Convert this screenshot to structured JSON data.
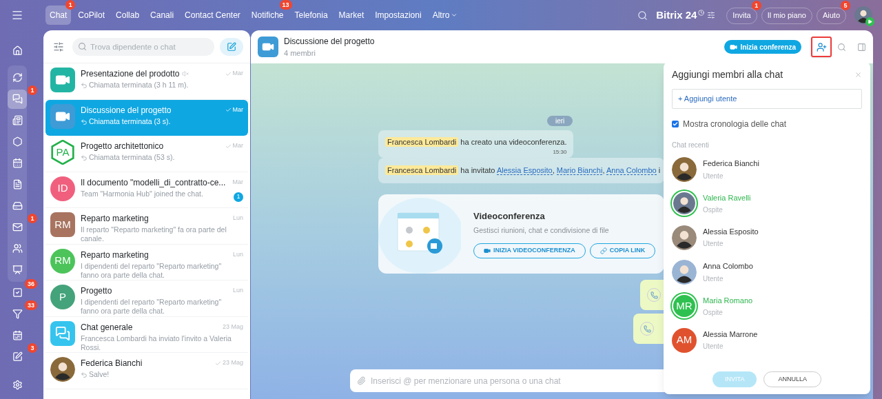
{
  "top_nav": {
    "items": [
      {
        "label": "Chat",
        "selected": true,
        "badge": "1"
      },
      {
        "label": "CoPilot",
        "selected": false
      },
      {
        "label": "Collab",
        "selected": false
      },
      {
        "label": "Canali",
        "selected": false
      },
      {
        "label": "Contact Center",
        "selected": false
      },
      {
        "label": "Notifiche",
        "selected": false,
        "badge": "13"
      },
      {
        "label": "Telefonia",
        "selected": false
      },
      {
        "label": "Market",
        "selected": false
      },
      {
        "label": "Impostazioni",
        "selected": false
      },
      {
        "label": "Altro",
        "selected": false,
        "dropdown": true
      }
    ],
    "logo": "Bitrix 24",
    "buttons": [
      {
        "label": "Invita",
        "badge": "1"
      },
      {
        "label": "Il mio piano"
      },
      {
        "label": "Aiuto",
        "badge": "5"
      }
    ]
  },
  "rail": {
    "top": [
      {
        "kind": "home",
        "selected": false
      }
    ],
    "group": [
      {
        "kind": "copilot",
        "selected": false
      },
      {
        "kind": "chat",
        "selected": true,
        "badge": "1"
      },
      {
        "kind": "feed",
        "selected": false
      },
      {
        "kind": "hexagon",
        "selected": false
      },
      {
        "kind": "calendar",
        "selected": false
      },
      {
        "kind": "document",
        "selected": false
      },
      {
        "kind": "drive",
        "selected": false
      },
      {
        "kind": "mail",
        "selected": false,
        "badge": "1"
      },
      {
        "kind": "users",
        "selected": false
      },
      {
        "kind": "board",
        "selected": false
      }
    ],
    "bottom": [
      {
        "kind": "tasks",
        "selected": false,
        "badge": "36"
      },
      {
        "kind": "funnel",
        "selected": false,
        "badge": "33"
      },
      {
        "kind": "schedule",
        "selected": false
      },
      {
        "kind": "sign",
        "selected": false,
        "badge": "3"
      },
      {
        "kind": "settings",
        "selected": false
      }
    ]
  },
  "chat_list": {
    "search": {
      "placeholder": "Trova dipendente o chat"
    },
    "items": [
      {
        "title": "Presentazione del prodotto",
        "preview": "Chiamata terminata (3 h 11 m).",
        "date": "Mar",
        "read": true,
        "reply": true,
        "muted": true,
        "avatar": {
          "kind": "video",
          "color": "#22b5a3"
        },
        "selected": false
      },
      {
        "title": "Discussione del progetto",
        "preview": "Chiamata terminata (3 s).",
        "date": "Mar",
        "read": true,
        "reply": true,
        "muted": false,
        "avatar": {
          "kind": "video",
          "color": "#3e9bd6"
        },
        "selected": true
      },
      {
        "title": "Progetto architettonico",
        "preview": "Chiamata terminata (53 s).",
        "date": "Mar",
        "read": true,
        "reply": true,
        "muted": false,
        "avatar": {
          "kind": "hexagon",
          "color": "#23b14a",
          "initials": "PA"
        },
        "selected": false
      },
      {
        "title": "Il documento \"modelli_di_contratto-ce...",
        "preview": "Team \"Harmonia Hub\" joined the chat.",
        "date": "Mar",
        "read": false,
        "reply": false,
        "muted": false,
        "unread": "1",
        "avatar": {
          "kind": "initials",
          "color": "#f0607e",
          "initials": "ID"
        },
        "selected": false
      },
      {
        "title": "Reparto marketing",
        "preview": "Il reparto \"Reparto marketing\" fa ora parte del canale.",
        "date": "Lun",
        "read": false,
        "reply": false,
        "muted": false,
        "avatar": {
          "kind": "square",
          "color": "#a87460",
          "initials": "RM"
        },
        "selected": false
      },
      {
        "title": "Reparto marketing",
        "preview": "I dipendenti del reparto \"Reparto marketing\" fanno ora parte della chat.",
        "date": "Lun",
        "read": false,
        "reply": false,
        "muted": false,
        "avatar": {
          "kind": "initials",
          "color": "#4cc45a",
          "initials": "RM"
        },
        "selected": false
      },
      {
        "title": "Progetto",
        "preview": "I dipendenti del reparto \"Reparto marketing\" fanno ora parte della chat.",
        "date": "Lun",
        "read": false,
        "reply": false,
        "muted": false,
        "avatar": {
          "kind": "initials",
          "color": "#44a37a",
          "initials": "P"
        },
        "selected": false
      },
      {
        "title": "Chat generale",
        "preview": "Francesca Lombardi ha inviato l'invito a Valeria Rossi.",
        "date": "23 Mag",
        "read": false,
        "reply": false,
        "muted": false,
        "avatar": {
          "kind": "app",
          "color": "#35c4ee"
        },
        "selected": false
      },
      {
        "title": "Federica Bianchi",
        "preview": "Salve!",
        "date": "23 Mag",
        "read": true,
        "reply": true,
        "muted": false,
        "avatar": {
          "kind": "photo",
          "color": "#8a6a3a"
        },
        "selected": false
      }
    ]
  },
  "chat": {
    "title": "Discussione del progetto",
    "subtitle": "4 membri",
    "conference_button": "Inizia conferenza",
    "add_user_highlighted": true,
    "date_chip": "ieri",
    "messages": [
      {
        "time": "15:30",
        "parts": [
          {
            "kind": "mention",
            "text": "Francesca Lombardi"
          },
          {
            "kind": "text",
            "text": " ha creato una videoconferenza."
          }
        ]
      },
      {
        "parts": [
          {
            "kind": "mention",
            "text": "Francesca Lombardi"
          },
          {
            "kind": "text",
            "text": " ha invitato "
          },
          {
            "kind": "link",
            "text": "Alessia Esposito"
          },
          {
            "kind": "text",
            "text": ", "
          },
          {
            "kind": "link",
            "text": "Mario Bianchi"
          },
          {
            "kind": "text",
            "text": ", "
          },
          {
            "kind": "link",
            "text": "Anna Colombo"
          },
          {
            "kind": "text",
            "text": " i"
          }
        ]
      }
    ],
    "video_card": {
      "title": "Videoconferenza",
      "description": "Gestisci riunioni, chat e condivisione di file",
      "buttons": [
        {
          "kind": "video",
          "label": "INIZIA VIDEOCONFERENZA"
        },
        {
          "kind": "link",
          "label": "COPIA LINK"
        }
      ]
    },
    "call_bubbles": [
      {
        "kind": "call"
      },
      {
        "kind": "call"
      }
    ],
    "composer": {
      "placeholder": "Inserisci @ per menzionare una persona o una chat"
    }
  },
  "dialog": {
    "title": "Aggiungi membri alla chat",
    "add_user": "+ Aggiungi utente",
    "history": {
      "label": "Mostra cronologia delle chat",
      "checked": true
    },
    "section": "Chat recenti",
    "members": [
      {
        "name": "Federica Bianchi",
        "role": "Utente",
        "guest": false,
        "avatar": {
          "kind": "photo",
          "color": "#8a6a3a"
        }
      },
      {
        "name": "Valeria Ravelli",
        "role": "Ospite",
        "guest": true,
        "avatar": {
          "kind": "photo",
          "color": "#6a7890"
        }
      },
      {
        "name": "Alessia Esposito",
        "role": "Utente",
        "guest": false,
        "avatar": {
          "kind": "photo",
          "color": "#9a8a7a"
        }
      },
      {
        "name": "Anna Colombo",
        "role": "Utente",
        "guest": false,
        "avatar": {
          "kind": "photo",
          "color": "#9ab4d4"
        }
      },
      {
        "name": "Maria Romano",
        "role": "Ospite",
        "guest": true,
        "avatar": {
          "kind": "initials",
          "color": "#2fc14f",
          "initials": "MR"
        }
      },
      {
        "name": "Alessia Marrone",
        "role": "Utente",
        "guest": false,
        "avatar": {
          "kind": "initials",
          "color": "#e0522e",
          "initials": "AM"
        }
      }
    ],
    "buttons": [
      {
        "label": "INVITA",
        "kind": "primary",
        "disabled": true
      },
      {
        "label": "ANNULLA",
        "kind": "secondary",
        "disabled": false
      }
    ]
  }
}
